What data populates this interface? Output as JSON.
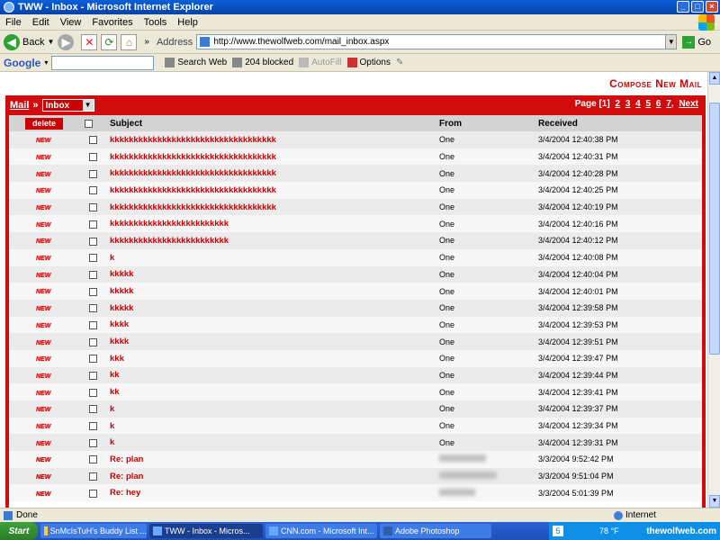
{
  "window": {
    "title": "TWW - Inbox - Microsoft Internet Explorer"
  },
  "menu": [
    "File",
    "Edit",
    "View",
    "Favorites",
    "Tools",
    "Help"
  ],
  "toolbar": {
    "back": "Back",
    "address_label": "Address",
    "url": "http://www.thewolfweb.com/mail_inbox.aspx",
    "go": "Go"
  },
  "googlebar": {
    "brand": "Google",
    "search_web": "Search Web",
    "blocked": "204 blocked",
    "autofill": "AutoFill",
    "options": "Options"
  },
  "page": {
    "compose": "Compose New Mail",
    "mail_link": "Mail",
    "breadcrumb_sep": "»",
    "folder": "Inbox",
    "pager_label": "Page",
    "current_page": "[1]",
    "pages": [
      "2",
      "3",
      "4",
      "5",
      "6",
      "7"
    ],
    "next": "Next",
    "delete_label": "delete",
    "col_subject": "Subject",
    "col_from": "From",
    "col_received": "Received",
    "new_label": "NEW"
  },
  "messages": [
    {
      "subject": "kkkkkkkkkkkkkkkkkkkkkkkkkkkkkkkkkkk",
      "from": "One",
      "received": "3/4/2004 12:40:38 PM",
      "read": false
    },
    {
      "subject": "kkkkkkkkkkkkkkkkkkkkkkkkkkkkkkkkkkk",
      "from": "One",
      "received": "3/4/2004 12:40:31 PM",
      "read": false
    },
    {
      "subject": "kkkkkkkkkkkkkkkkkkkkkkkkkkkkkkkkkkk",
      "from": "One",
      "received": "3/4/2004 12:40:28 PM",
      "read": false
    },
    {
      "subject": "kkkkkkkkkkkkkkkkkkkkkkkkkkkkkkkkkkk",
      "from": "One",
      "received": "3/4/2004 12:40:25 PM",
      "read": false
    },
    {
      "subject": "kkkkkkkkkkkkkkkkkkkkkkkkkkkkkkkkkkk",
      "from": "One",
      "received": "3/4/2004 12:40:19 PM",
      "read": false
    },
    {
      "subject": "kkkkkkkkkkkkkkkkkkkkkkkkk",
      "from": "One",
      "received": "3/4/2004 12:40:16 PM",
      "read": false
    },
    {
      "subject": "kkkkkkkkkkkkkkkkkkkkkkkkk",
      "from": "One",
      "received": "3/4/2004 12:40:12 PM",
      "read": false
    },
    {
      "subject": "k",
      "from": "One",
      "received": "3/4/2004 12:40:08 PM",
      "read": false
    },
    {
      "subject": "kkkkk",
      "from": "One",
      "received": "3/4/2004 12:40:04 PM",
      "read": false
    },
    {
      "subject": "kkkkk",
      "from": "One",
      "received": "3/4/2004 12:40:01 PM",
      "read": false
    },
    {
      "subject": "kkkkk",
      "from": "One",
      "received": "3/4/2004 12:39:58 PM",
      "read": false
    },
    {
      "subject": "kkkk",
      "from": "One",
      "received": "3/4/2004 12:39:53 PM",
      "read": false
    },
    {
      "subject": "kkkk",
      "from": "One",
      "received": "3/4/2004 12:39:51 PM",
      "read": false
    },
    {
      "subject": "kkk",
      "from": "One",
      "received": "3/4/2004 12:39:47 PM",
      "read": false
    },
    {
      "subject": "kk",
      "from": "One",
      "received": "3/4/2004 12:39:44 PM",
      "read": false
    },
    {
      "subject": "kk",
      "from": "One",
      "received": "3/4/2004 12:39:41 PM",
      "read": false
    },
    {
      "subject": "k",
      "from": "One",
      "received": "3/4/2004 12:39:37 PM",
      "read": false
    },
    {
      "subject": "k",
      "from": "One",
      "received": "3/4/2004 12:39:34 PM",
      "read": false
    },
    {
      "subject": "k",
      "from": "One",
      "received": "3/4/2004 12:39:31 PM",
      "read": false
    },
    {
      "subject": "Re: plan",
      "from": "",
      "received": "3/3/2004 9:52:42 PM",
      "read": true
    },
    {
      "subject": "Re: plan",
      "from": "",
      "received": "3/3/2004 9:51:04 PM",
      "read": true
    },
    {
      "subject": "Re: hey",
      "from": "",
      "received": "3/3/2004 5:01:39 PM",
      "read": true
    }
  ],
  "statusbar": {
    "status": "Done",
    "zone": "Internet"
  },
  "taskbar": {
    "start": "Start",
    "tasks": [
      "SnMcIsTuH's Buddy List ...",
      "TWW - Inbox - Micros...",
      "CNN.com - Microsoft Int...",
      "Adobe Photoshop"
    ],
    "weather": "78 °F",
    "brand": "thewolfweb.com"
  }
}
